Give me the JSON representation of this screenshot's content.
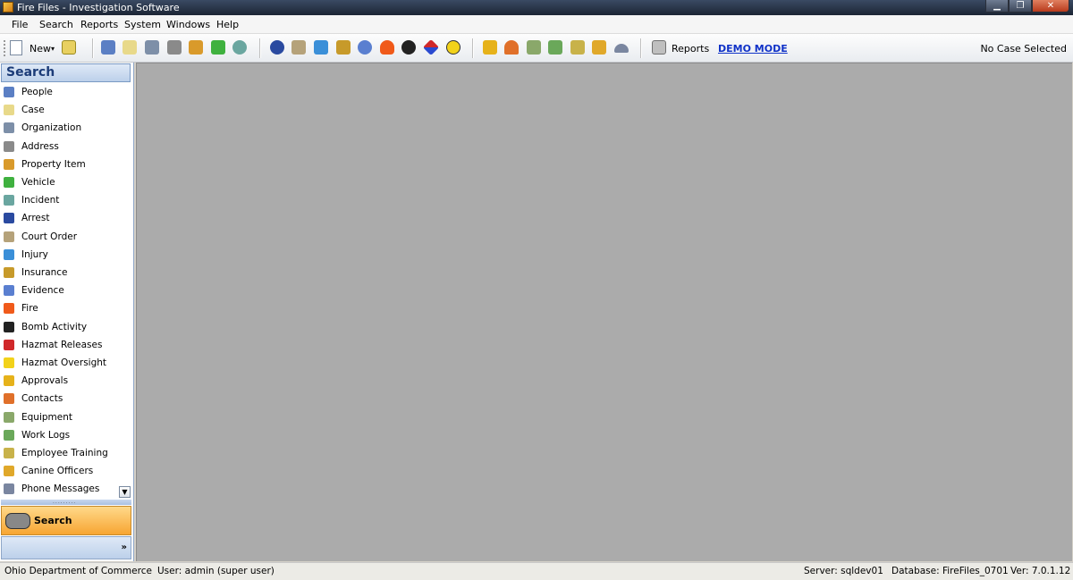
{
  "window": {
    "title": "Fire Files - Investigation Software"
  },
  "menu": [
    "File",
    "Search",
    "Reports",
    "System",
    "Windows",
    "Help"
  ],
  "toolbar": {
    "new_label": "New",
    "reports_label": "Reports",
    "demo_mode": "DEMO MODE",
    "case_status": "No Case Selected",
    "icons": [
      "add-folder-icon",
      "people-icon",
      "case-icon",
      "organization-icon",
      "address-icon",
      "property-item-icon",
      "vehicle-icon",
      "incident-icon",
      "arrest-icon",
      "court-order-icon",
      "injury-icon",
      "insurance-icon",
      "evidence-icon",
      "fire-icon",
      "bomb-icon",
      "hazmat-releases-icon",
      "hazmat-oversight-icon",
      "approvals-icon",
      "contacts-icon",
      "equipment-icon",
      "work-logs-icon",
      "employee-training-icon",
      "canine-officers-icon",
      "phone-messages-icon",
      "reports-icon"
    ]
  },
  "sidebar": {
    "header": "Search",
    "items": [
      {
        "label": "People",
        "icon": "people-icon",
        "color": "#5b7fc4"
      },
      {
        "label": "Case",
        "icon": "case-icon",
        "color": "#e8d98a"
      },
      {
        "label": "Organization",
        "icon": "organization-icon",
        "color": "#7d8fa8"
      },
      {
        "label": "Address",
        "icon": "address-icon",
        "color": "#8a8a8a"
      },
      {
        "label": "Property Item",
        "icon": "property-item-icon",
        "color": "#d99a2b"
      },
      {
        "label": "Vehicle",
        "icon": "vehicle-icon",
        "color": "#3fb13f"
      },
      {
        "label": "Incident",
        "icon": "incident-icon",
        "color": "#6aa6a0"
      },
      {
        "label": "Arrest",
        "icon": "arrest-icon",
        "color": "#2a4aa0"
      },
      {
        "label": "Court Order",
        "icon": "court-order-icon",
        "color": "#b5a27a"
      },
      {
        "label": "Injury",
        "icon": "injury-icon",
        "color": "#3a8fd8"
      },
      {
        "label": "Insurance",
        "icon": "insurance-icon",
        "color": "#c79a2a"
      },
      {
        "label": "Evidence",
        "icon": "evidence-icon",
        "color": "#5a7fd0"
      },
      {
        "label": "Fire",
        "icon": "fire-icon",
        "color": "#f05a1a"
      },
      {
        "label": "Bomb Activity",
        "icon": "bomb-icon",
        "color": "#222222"
      },
      {
        "label": "Hazmat Releases",
        "icon": "hazmat-releases-icon",
        "color": "#d0282a"
      },
      {
        "label": "Hazmat Oversight",
        "icon": "hazmat-oversight-icon",
        "color": "#f2d21a"
      },
      {
        "label": "Approvals",
        "icon": "approvals-icon",
        "color": "#e6b21a"
      },
      {
        "label": "Contacts",
        "icon": "contacts-icon",
        "color": "#e0702a"
      },
      {
        "label": "Equipment",
        "icon": "equipment-icon",
        "color": "#8aa86a"
      },
      {
        "label": "Work Logs",
        "icon": "work-logs-icon",
        "color": "#6aa85a"
      },
      {
        "label": "Employee Training",
        "icon": "employee-training-icon",
        "color": "#c8b24a"
      },
      {
        "label": "Canine Officers",
        "icon": "canine-officers-icon",
        "color": "#e0a82a"
      },
      {
        "label": "Phone Messages",
        "icon": "phone-messages-icon",
        "color": "#7a86a0"
      }
    ],
    "nav_button_label": "Search"
  },
  "status": {
    "organization": "Ohio Department of Commerce",
    "user": "User: admin (super user)",
    "server": "Server: sqldev01",
    "database": "Database: FireFiles_0701",
    "version": "Ver: 7.0.1.12"
  }
}
